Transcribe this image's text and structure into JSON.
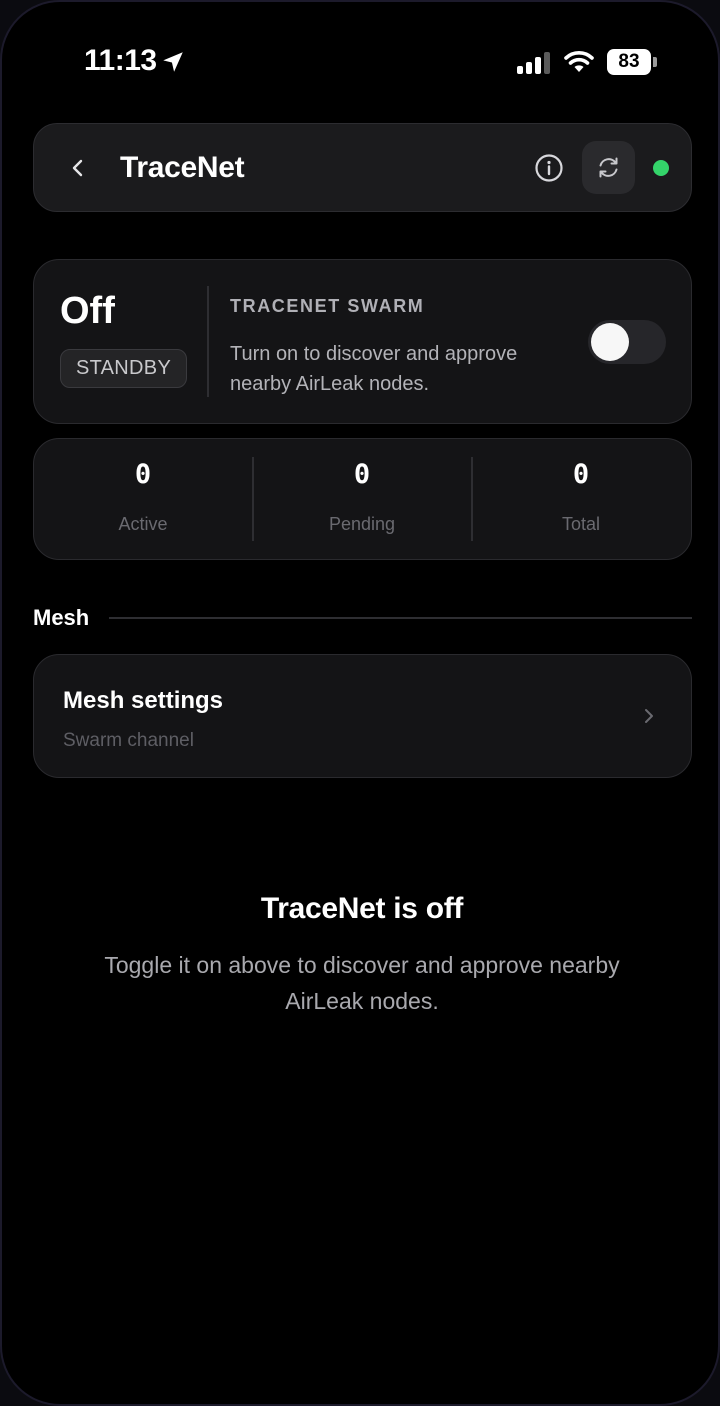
{
  "status_bar": {
    "time": "11:13",
    "battery": "83",
    "icons": [
      "location-arrow-icon",
      "cellular-signal-icon",
      "wifi-icon",
      "battery-icon"
    ]
  },
  "header": {
    "title": "TraceNet",
    "icons": [
      "chevron-left-icon",
      "info-icon",
      "refresh-icon"
    ],
    "connection_status_color": "#34d46a"
  },
  "swarm": {
    "state": "Off",
    "badge": "STANDBY",
    "heading": "TRACENET SWARM",
    "description": "Turn on to discover and approve nearby AirLeak nodes.",
    "toggle_on": false
  },
  "stats": [
    {
      "value": "0",
      "label": "Active"
    },
    {
      "value": "0",
      "label": "Pending"
    },
    {
      "value": "0",
      "label": "Total"
    }
  ],
  "mesh": {
    "section_title": "Mesh",
    "settings_title": "Mesh settings",
    "settings_subtitle": "Swarm channel"
  },
  "empty_state": {
    "title": "TraceNet is off",
    "description": "Toggle it on above to discover and approve nearby AirLeak nodes."
  },
  "colors": {
    "background": "#000000",
    "card": "#141416",
    "accent_green": "#34d46a"
  }
}
